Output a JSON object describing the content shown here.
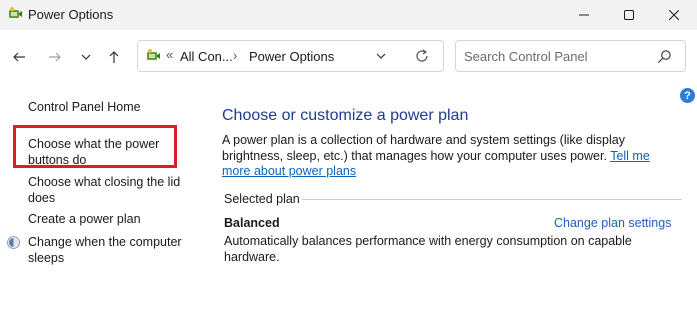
{
  "window": {
    "title": "Power Options"
  },
  "toolbar": {
    "breadcrumb_overflow": "«",
    "crumbs": [
      "All Con...",
      "Power Options"
    ],
    "separator": "›",
    "search_placeholder": "Search Control Panel"
  },
  "help": {
    "glyph": "?"
  },
  "sidebar": {
    "items": [
      {
        "label": "Control Panel Home"
      },
      {
        "label": "Choose what the power buttons do"
      },
      {
        "label": "Choose what closing the lid does"
      },
      {
        "label": "Create a power plan"
      },
      {
        "label": "Change when the computer sleeps"
      }
    ]
  },
  "main": {
    "title": "Choose or customize a power plan",
    "description": "A power plan is a collection of hardware and system settings (like display brightness, sleep, etc.) that manages how your computer uses power.",
    "learn_more_link": "Tell me more about power plans",
    "section_label": "Selected plan",
    "plan": {
      "name": "Balanced",
      "change_link": "Change plan settings",
      "description": "Automatically balances performance with energy consumption on capable hardware."
    }
  },
  "colors": {
    "highlight": "#d6202a",
    "link": "#0b64c0",
    "heading": "#1e3d8f"
  },
  "icons": [
    "power-options-icon",
    "minimize-icon",
    "maximize-icon",
    "close-icon",
    "back-arrow-icon",
    "forward-arrow-icon",
    "chevron-down-icon",
    "up-arrow-icon",
    "refresh-icon",
    "search-icon",
    "help-icon",
    "sleep-shield-icon"
  ]
}
